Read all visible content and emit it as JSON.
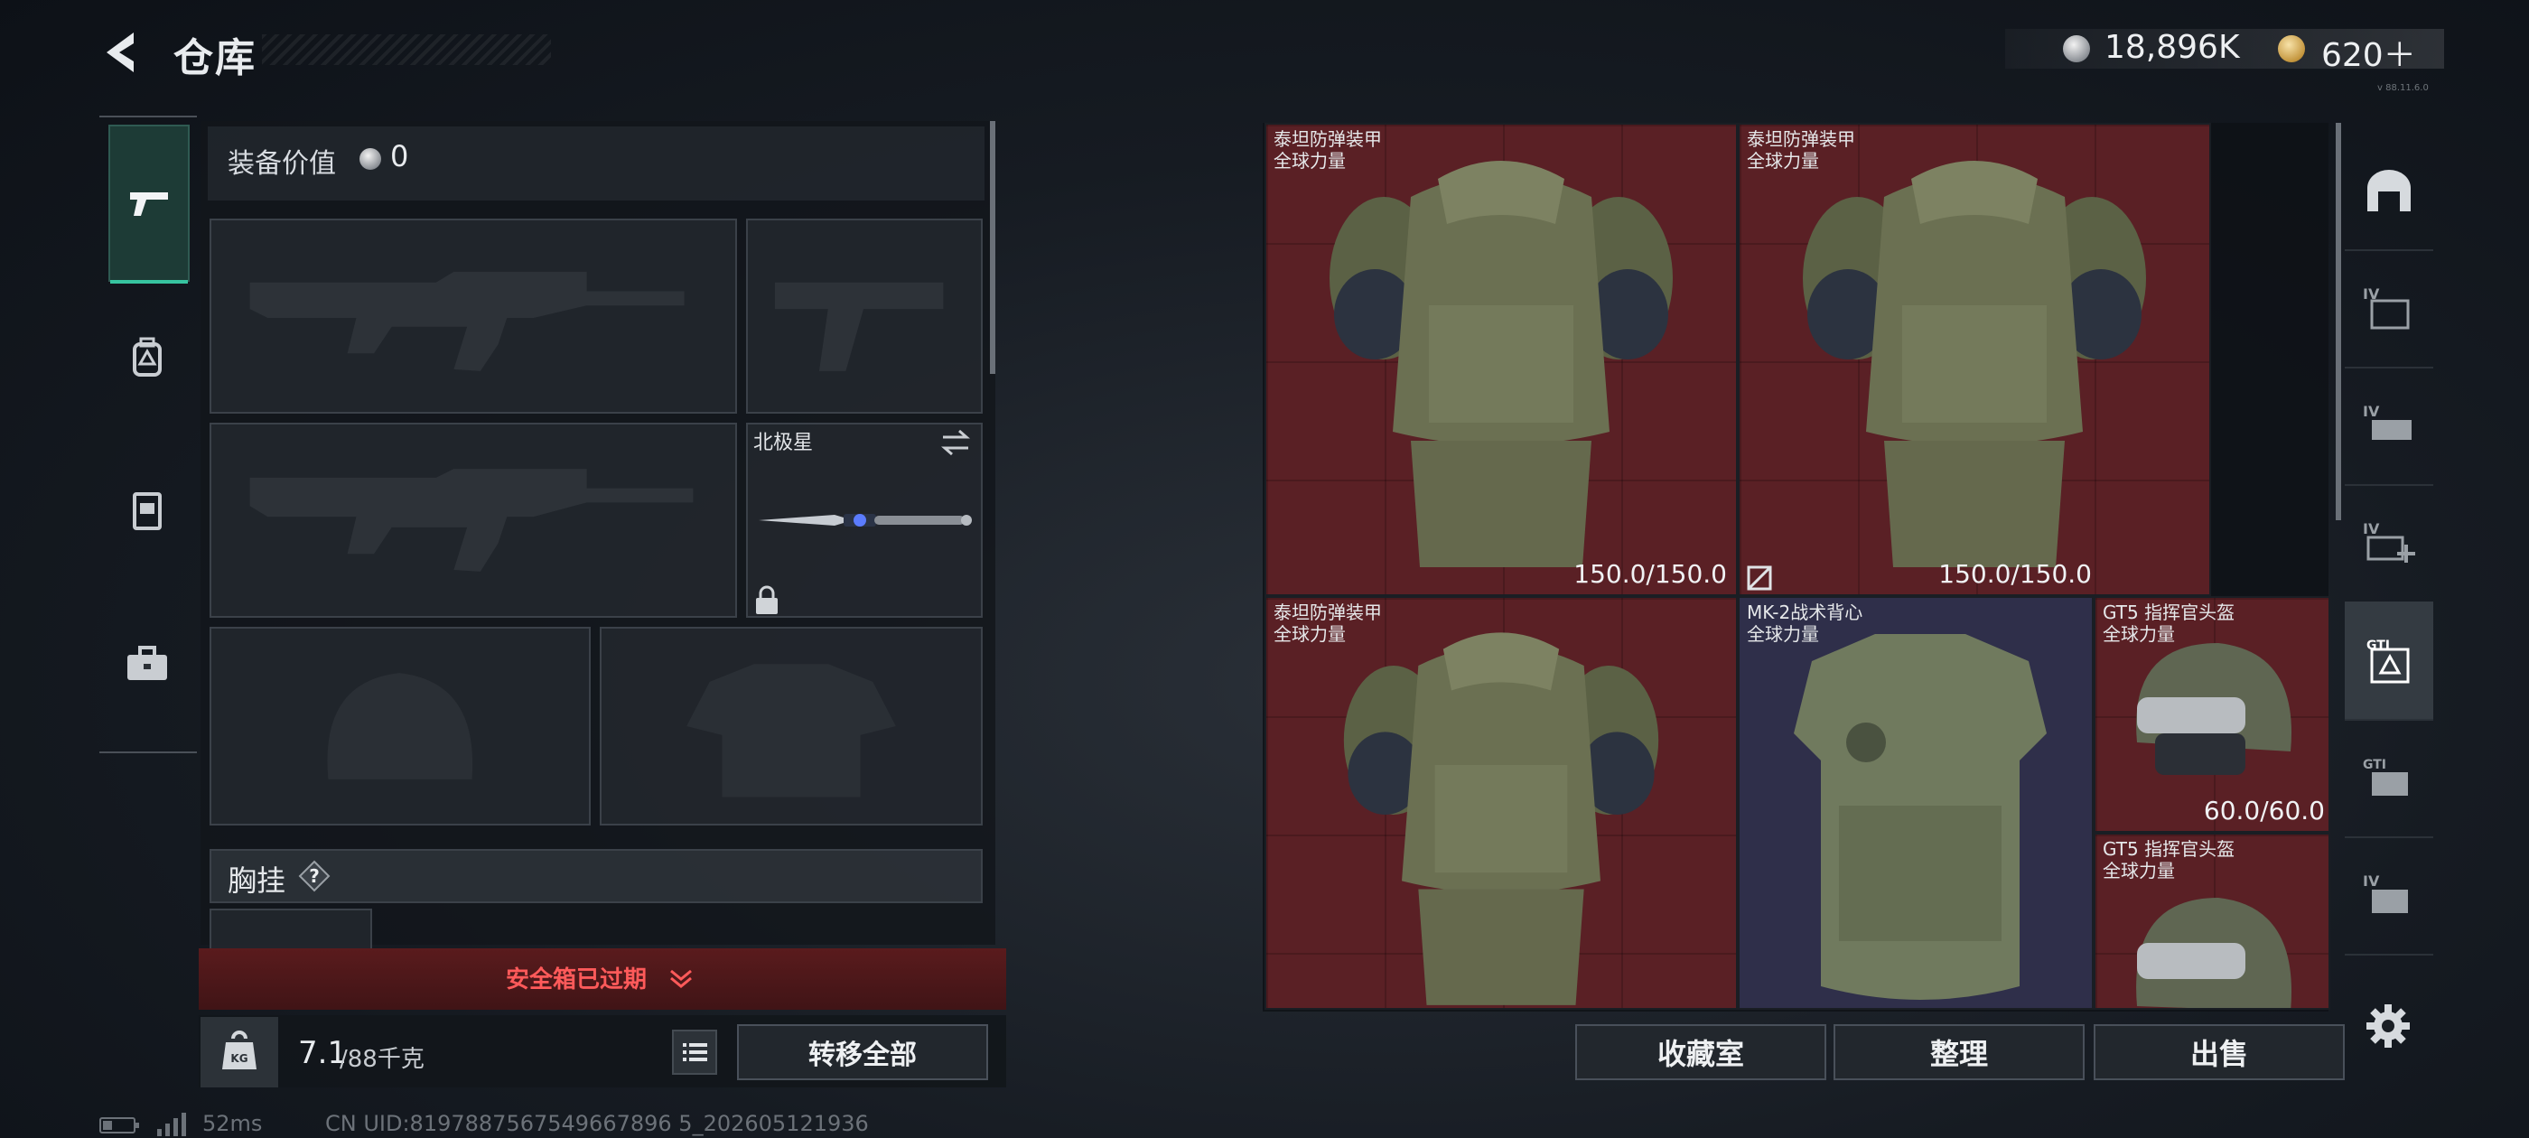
{
  "header": {
    "title": "仓库",
    "currency_coins": "18,896K",
    "currency_premium": "620＋",
    "version": "v 88.11.6.0"
  },
  "loadout": {
    "equip_value_label": "装备价值",
    "equip_value": "0",
    "melee_name": "北极星",
    "chest_rig_label": "胸挂",
    "safe_box_status": "安全箱已过期",
    "weight_value": "7.1",
    "weight_max": "/88千克",
    "transfer_all": "转移全部"
  },
  "warehouse": {
    "items": [
      {
        "name": "泰坦防弹装甲",
        "faction": "全球力量",
        "durability": "150.0/150.0",
        "bg": "#5a2025"
      },
      {
        "name": "泰坦防弹装甲",
        "faction": "全球力量",
        "durability": "150.0/150.0",
        "bg": "#5a2025"
      },
      {
        "name": "泰坦防弹装甲",
        "faction": "全球力量",
        "durability": "",
        "bg": "#5a2025"
      },
      {
        "name": "MK-2战术背心",
        "faction": "全球力量",
        "durability": "",
        "bg": "#2f2f4a"
      },
      {
        "name": "GT5 指挥官头盔",
        "faction": "全球力量",
        "durability": "60.0/60.0",
        "bg": "#5a2025"
      },
      {
        "name": "GT5 指挥官头盔",
        "faction": "全球力量",
        "durability": "",
        "bg": "#5a2025"
      }
    ],
    "buttons": {
      "collection": "收藏室",
      "sort": "整理",
      "sell": "出售"
    }
  },
  "status_bar": {
    "ping": "52ms",
    "uid": "CN UID:8197887567549667896 5_202605121936"
  }
}
